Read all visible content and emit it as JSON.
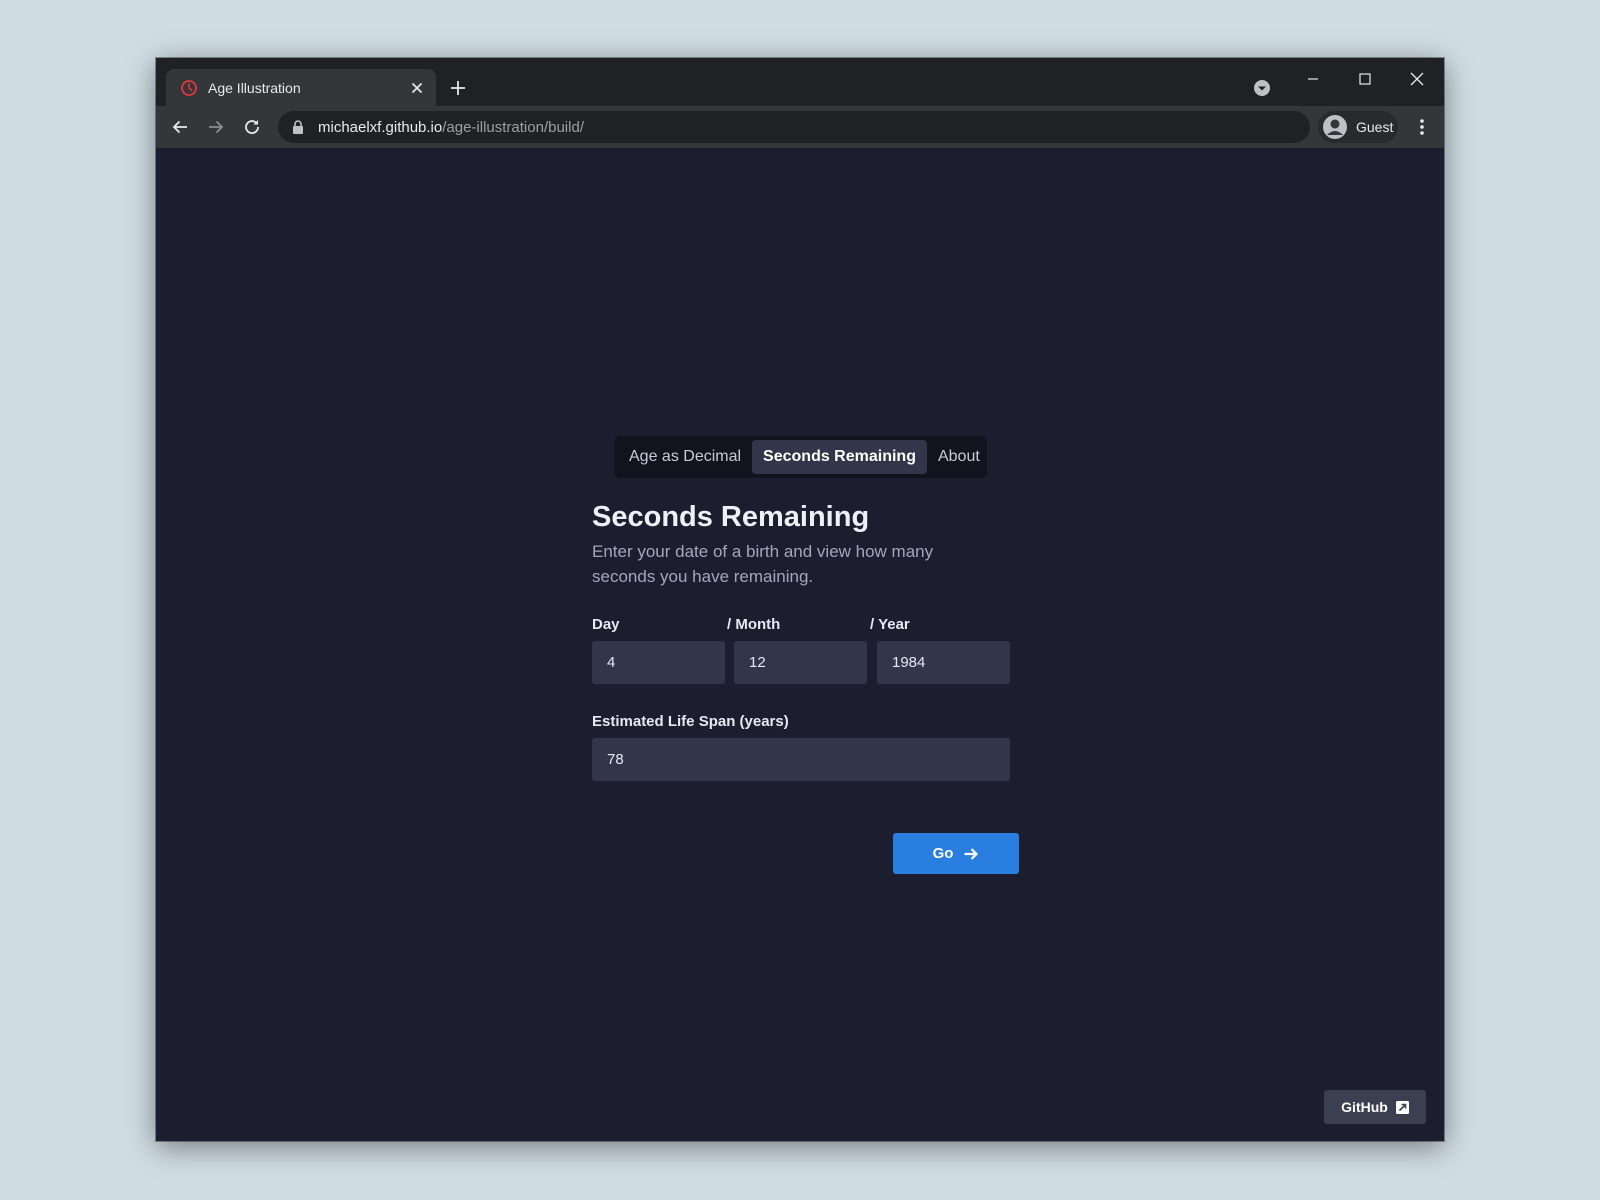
{
  "browser": {
    "tab_title": "Age Illustration",
    "url_host": "michaelxf.github.io",
    "url_path": "/age-illustration/build/",
    "profile_label": "Guest"
  },
  "nav": {
    "tabs": [
      {
        "label": "Age as Decimal",
        "active": false
      },
      {
        "label": "Seconds Remaining",
        "active": true
      },
      {
        "label": "About",
        "active": false
      }
    ]
  },
  "form": {
    "heading": "Seconds Remaining",
    "subtitle": "Enter your date of a birth and view how many seconds you have remaining.",
    "day_label": "Day",
    "month_label": "/ Month",
    "year_label": "/ Year",
    "day_value": "4",
    "month_value": "12",
    "year_value": "1984",
    "lifespan_label": "Estimated Life Span (years)",
    "lifespan_value": "78",
    "go_label": "Go"
  },
  "footer": {
    "github_label": "GitHub"
  },
  "colors": {
    "page_background": "#1c1d2e",
    "accent": "#2a7ee0",
    "input_background": "#33354b"
  },
  "icons": {
    "favicon": "clock-icon",
    "go": "arrow-right-icon",
    "github": "external-link-icon"
  }
}
